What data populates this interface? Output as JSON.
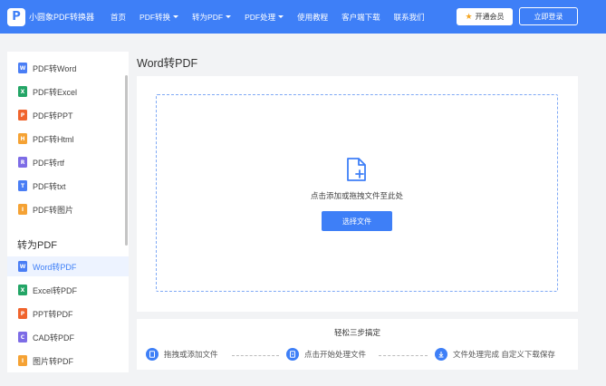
{
  "header": {
    "logo_text": "小圆象PDF转换器",
    "nav": [
      {
        "label": "首页",
        "dropdown": false
      },
      {
        "label": "PDF转换",
        "dropdown": true
      },
      {
        "label": "转为PDF",
        "dropdown": true
      },
      {
        "label": "PDF处理",
        "dropdown": true
      },
      {
        "label": "使用教程",
        "dropdown": false
      },
      {
        "label": "客户端下载",
        "dropdown": false
      },
      {
        "label": "联系我们",
        "dropdown": false
      }
    ],
    "vip_button": "开通会员",
    "login_button": "立即登录"
  },
  "sidebar": {
    "group1": [
      {
        "label": "PDF转Word",
        "icon": "word-file-icon",
        "color": "#4a7ef5"
      },
      {
        "label": "PDF转Excel",
        "icon": "excel-file-icon",
        "color": "#23a566"
      },
      {
        "label": "PDF转PPT",
        "icon": "ppt-file-icon",
        "color": "#f0642d"
      },
      {
        "label": "PDF转Html",
        "icon": "html-file-icon",
        "color": "#f5a234"
      },
      {
        "label": "PDF转rtf",
        "icon": "rtf-file-icon",
        "color": "#7d6ce6"
      },
      {
        "label": "PDF转txt",
        "icon": "txt-file-icon",
        "color": "#4a7ef5"
      },
      {
        "label": "PDF转图片",
        "icon": "image-file-icon",
        "color": "#f5a234"
      }
    ],
    "section2_title": "转为PDF",
    "group2": [
      {
        "label": "Word转PDF",
        "icon": "word-file-icon",
        "color": "#4a7ef5",
        "active": true
      },
      {
        "label": "Excel转PDF",
        "icon": "excel-file-icon",
        "color": "#23a566"
      },
      {
        "label": "PPT转PDF",
        "icon": "ppt-file-icon",
        "color": "#f0642d"
      },
      {
        "label": "CAD转PDF",
        "icon": "cad-file-icon",
        "color": "#7d6ce6"
      },
      {
        "label": "图片转PDF",
        "icon": "image-file-icon",
        "color": "#f5a234"
      }
    ]
  },
  "main": {
    "title": "Word转PDF",
    "drop_text": "点击添加或拖拽文件至此处",
    "choose_button": "选择文件"
  },
  "steps": {
    "title": "轻松三步搞定",
    "items": [
      {
        "label": "拖拽或添加文件",
        "icon": "file-add-icon"
      },
      {
        "label": "点击开始处理文件",
        "icon": "process-icon"
      },
      {
        "label": "文件处理完成 自定义下载保存",
        "icon": "download-icon"
      }
    ]
  },
  "colors": {
    "accent": "#3e7ff7",
    "background": "#f2f3f5"
  }
}
